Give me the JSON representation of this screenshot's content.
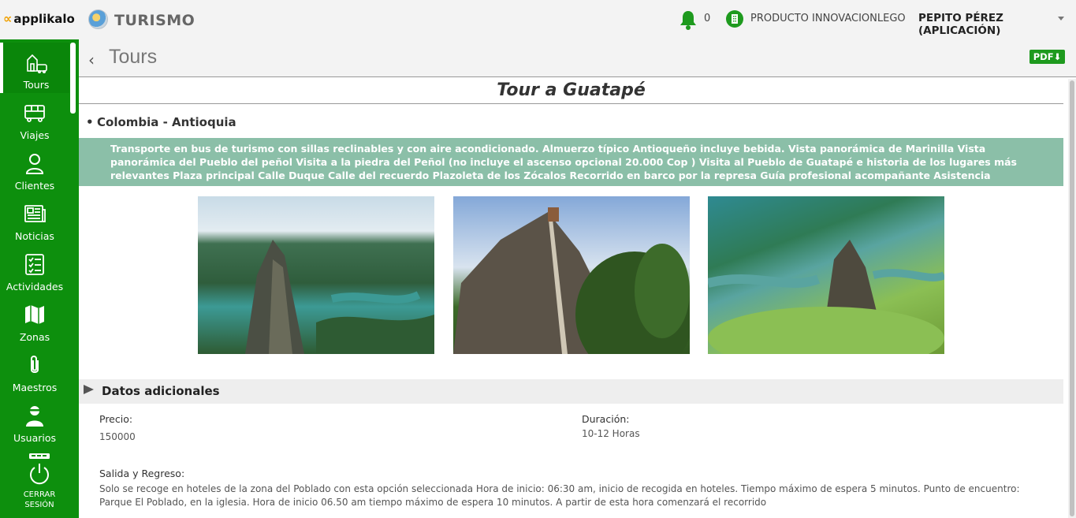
{
  "topbar": {
    "logo_text": "applikalo",
    "app_title": "TURISMO",
    "notification_count": "0",
    "company": "PRODUCTO INNOVACIONLEGO",
    "user": "PEPITO PÉREZ (APLICACIÓN)"
  },
  "sidebar": {
    "items": [
      {
        "label": "Tours",
        "icon": "tours-icon"
      },
      {
        "label": "Viajes",
        "icon": "bus-icon"
      },
      {
        "label": "Clientes",
        "icon": "user-icon"
      },
      {
        "label": "Noticias",
        "icon": "newspaper-icon"
      },
      {
        "label": "Actividades",
        "icon": "checklist-icon"
      },
      {
        "label": "Zonas",
        "icon": "map-icon"
      },
      {
        "label": "Maestros",
        "icon": "paperclip-icon"
      },
      {
        "label": "Usuarios",
        "icon": "users-icon"
      }
    ],
    "logout_line1": "CERRAR",
    "logout_line2": "SESIÓN"
  },
  "header": {
    "back_icon": "chevron-left-icon",
    "title": "Tours",
    "pdf_label": "PDF"
  },
  "tour": {
    "title": "Tour a Guatapé",
    "location": "Colombia - Antioquia",
    "description": "Transporte en bus de turismo con sillas reclinables y con aire acondicionado. Almuerzo típico Antioqueño incluye bebida. Vista panorámica de Marinilla Vista panorámica del Pueblo del peñol Visita a la piedra del Peñol (no incluye el ascenso opcional 20.000 Cop ) Visita al Pueblo de Guatapé e historia de los lugares más relevantes Plaza principal Calle Duque Calle del recuerdo Plazoleta de los Zócalos Recorrido en barco por la represa Guía profesional acompañante Asistencia"
  },
  "datos": {
    "section_title": "Datos adicionales",
    "precio_label": "Precio:",
    "precio_value": "150000",
    "duracion_label": "Duración:",
    "duracion_value": "10-12 Horas",
    "salida_label": "Salida y Regreso:",
    "salida_value": "Solo se recoge en hoteles de la zona del Poblado con esta opción seleccionada Hora de inicio: 06:30 am, inicio de recogida en hoteles. Tiempo máximo de espera 5 minutos. Punto de encuentro: Parque El Poblado, en la iglesia. Hora de inicio 06.50 am tiempo máximo de espera 10 minutos. A partir de esta hora comenzará el recorrido"
  },
  "colors": {
    "brand_green": "#0d8f0d",
    "description_bg": "#8bbfa8"
  }
}
